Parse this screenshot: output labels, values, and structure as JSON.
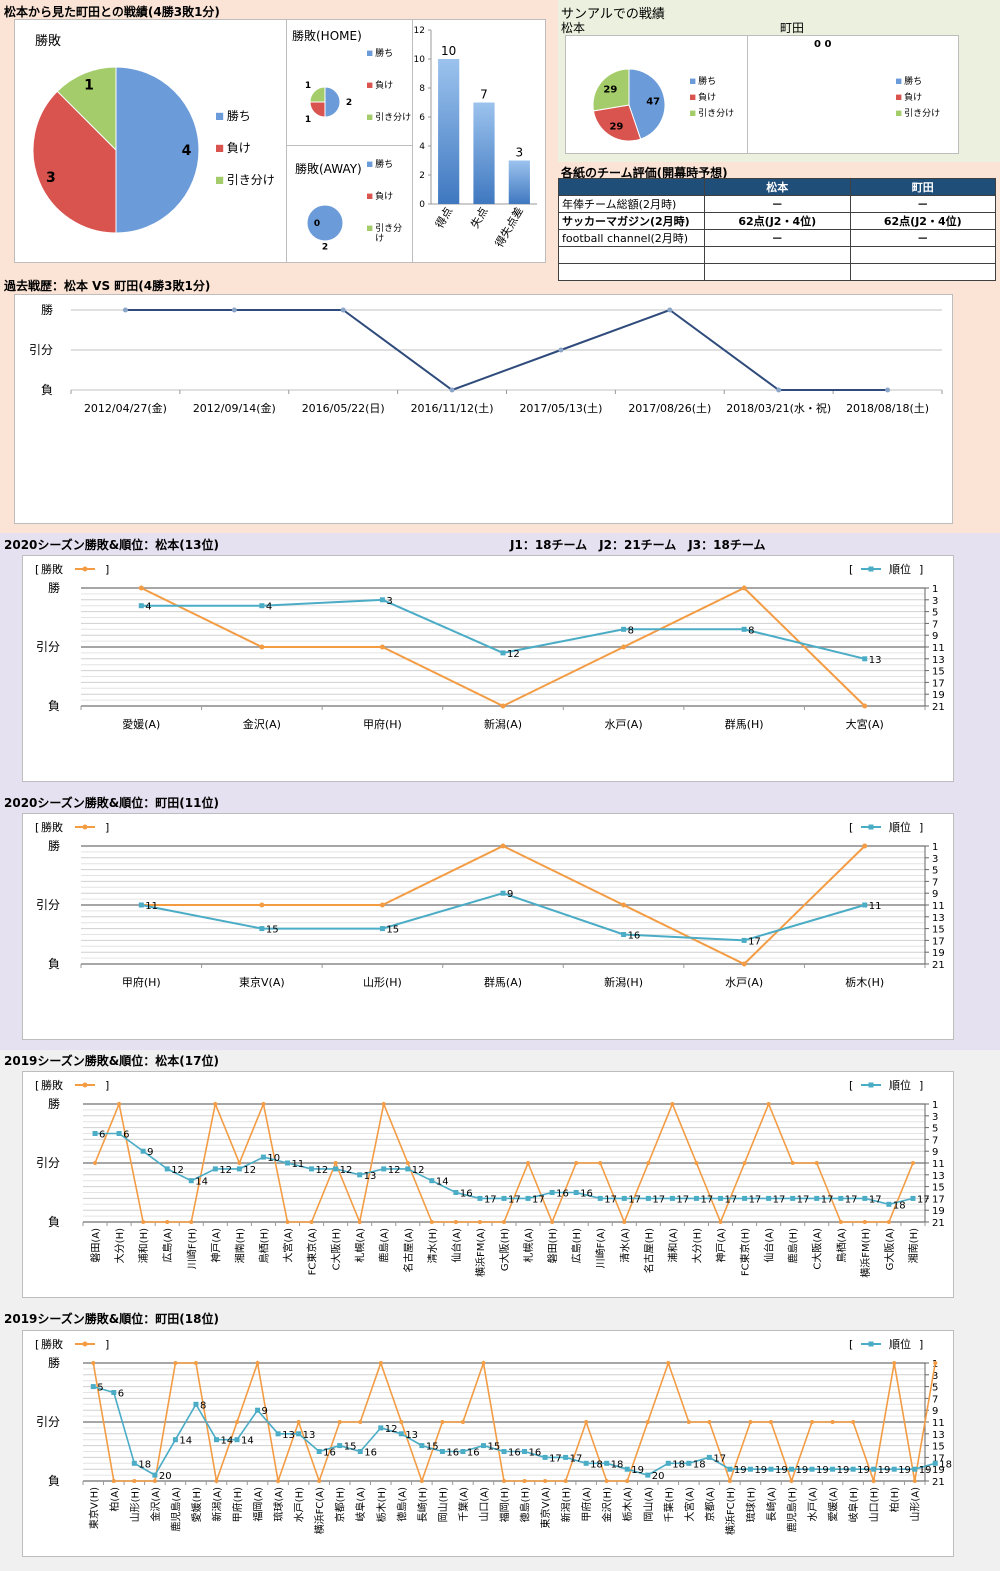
{
  "colors": {
    "win": "#6b9bd8",
    "loss": "#d9534f",
    "draw": "#a4cc6a",
    "orange": "#f39c44",
    "teal": "#4bacc6",
    "navy": "#2f4b7c",
    "peach": "#fbe4d6",
    "lav": "#e6e1f0",
    "gray": "#f0f0f0"
  },
  "head2head": {
    "title": "松本から見た町田との戦績(4勝3敗1分)",
    "pie_title": "勝敗",
    "home_title": "勝敗(HOME)",
    "away_title": "勝敗(AWAY)",
    "legend": [
      "勝ち",
      "負け",
      "引き分け"
    ],
    "legend_small": [
      "勝ち",
      "負け",
      "引き分\nけ"
    ]
  },
  "sanaru": {
    "title": "サンアルでの戦績",
    "left_label": "松本",
    "right_label": "町田",
    "right_zero": "0 0"
  },
  "eval_table": {
    "title": "各紙のチーム評価(開幕時予想)",
    "headers": [
      "",
      "松本",
      "町田"
    ],
    "rows": [
      [
        "年俸チーム総額(2月時)",
        "－",
        "－"
      ],
      [
        "サッカーマガジン(2月時)",
        "62点(J2・4位)",
        "62点(J2・4位)"
      ],
      [
        "football channel(2月時)",
        "－",
        "－"
      ],
      [
        "",
        "",
        ""
      ],
      [
        "",
        "",
        ""
      ]
    ]
  },
  "history": {
    "title": "過去戦歴：松本 VS 町田(4勝3敗1分)"
  },
  "s2020m": {
    "title": "2020シーズン勝敗&順位：松本(13位)",
    "info": "J1：18チーム　J2：21チーム　J3：18チーム"
  },
  "s2020z": {
    "title": "2020シーズン勝敗&順位：町田(11位)"
  },
  "s2019m": {
    "title": "2019シーズン勝敗&順位：松本(17位)"
  },
  "s2019z": {
    "title": "2019シーズン勝敗&順位：町田(18位)"
  },
  "chart_data": [
    {
      "id": "pie_overall",
      "type": "pie",
      "title": "勝敗",
      "labels": [
        "勝ち",
        "負け",
        "引き分け"
      ],
      "values": [
        4,
        3,
        1
      ]
    },
    {
      "id": "pie_home",
      "type": "pie",
      "title": "勝敗(HOME)",
      "labels": [
        "勝ち",
        "負け",
        "引き分け"
      ],
      "values": [
        2,
        1,
        1
      ]
    },
    {
      "id": "pie_away",
      "type": "pie",
      "title": "勝敗(AWAY)",
      "labels": [
        "勝ち",
        "負け",
        "引き分け"
      ],
      "values": [
        2,
        0,
        0
      ]
    },
    {
      "id": "bar_goals",
      "type": "bar",
      "categories": [
        "得点",
        "失点",
        "得失点差"
      ],
      "values": [
        10,
        7,
        3
      ],
      "ylim": [
        0,
        12
      ],
      "yticks": [
        0,
        2,
        4,
        6,
        8,
        10,
        12
      ]
    },
    {
      "id": "pie_sanaru",
      "type": "pie",
      "labels": [
        "勝ち",
        "負け",
        "引き分け"
      ],
      "values": [
        47,
        29,
        29
      ]
    },
    {
      "id": "pie_sanaru_z",
      "type": "pie",
      "labels": [
        "勝ち",
        "負け",
        "引き分け"
      ],
      "values": [
        0,
        0,
        0
      ]
    },
    {
      "id": "history",
      "type": "line",
      "categories": [
        "2012/04/27(金)",
        "2012/09/14(金)",
        "2016/05/22(日)",
        "2016/11/12(土)",
        "2017/05/13(土)",
        "2017/08/26(土)",
        "2018/03/21(水・祝)",
        "2018/08/18(土)"
      ],
      "ylabels": [
        "勝",
        "引分",
        "負"
      ],
      "values": [
        1,
        1,
        1,
        -1,
        0,
        1,
        -1,
        -1
      ]
    },
    {
      "id": "s2020m",
      "type": "line",
      "legend_result": "勝敗",
      "legend_rank": "順位",
      "ylabels": [
        "勝",
        "引分",
        "負"
      ],
      "rank_ticks": [
        1,
        3,
        5,
        7,
        9,
        11,
        13,
        15,
        17,
        19,
        21
      ],
      "categories": [
        "愛媛(A)",
        "金沢(A)",
        "甲府(H)",
        "新潟(A)",
        "水戸(A)",
        "群馬(H)",
        "大宮(A)"
      ],
      "result": [
        1,
        0,
        0,
        -1,
        0,
        1,
        -1
      ],
      "rank": [
        4,
        4,
        3,
        12,
        8,
        8,
        13
      ]
    },
    {
      "id": "s2020z",
      "type": "line",
      "legend_result": "勝敗",
      "legend_rank": "順位",
      "ylabels": [
        "勝",
        "引分",
        "負"
      ],
      "rank_ticks": [
        1,
        3,
        5,
        7,
        9,
        11,
        13,
        15,
        17,
        19,
        21
      ],
      "categories": [
        "甲府(H)",
        "東京V(A)",
        "山形(H)",
        "群馬(A)",
        "新潟(H)",
        "水戸(A)",
        "栃木(H)"
      ],
      "result": [
        0,
        0,
        0,
        1,
        0,
        -1,
        1
      ],
      "rank": [
        11,
        15,
        15,
        9,
        16,
        17,
        11
      ]
    },
    {
      "id": "s2019m",
      "type": "line",
      "legend_result": "勝敗",
      "legend_rank": "順位",
      "ylabels": [
        "勝",
        "引分",
        "負"
      ],
      "rank_ticks": [
        1,
        3,
        5,
        7,
        9,
        11,
        13,
        15,
        17,
        19,
        21
      ],
      "categories": [
        "磐田(A)",
        "大分(H)",
        "浦和(H)",
        "広島(A)",
        "川崎F(H)",
        "神戸(A)",
        "湘南(H)",
        "鳥栖(H)",
        "大宮(A)",
        "FC東京(A)",
        "C大阪(H)",
        "札幌(A)",
        "鹿島(A)",
        "名古屋(A)",
        "清水(H)",
        "仙台(A)",
        "横浜FM(A)",
        "G大阪(H)",
        "札幌(A)",
        "磐田(H)",
        "広島(H)",
        "川崎F(A)",
        "清水(A)",
        "名古屋(H)",
        "浦和(A)",
        "大分(H)",
        "神戸(A)",
        "FC東京(H)",
        "仙台(A)",
        "鹿島(H)",
        "C大阪(A)",
        "鳥栖(A)",
        "横浜FM(H)",
        "G大阪(A)",
        "湘南(H)"
      ],
      "result": [
        0,
        1,
        -1,
        -1,
        -1,
        1,
        0,
        1,
        -1,
        -1,
        0,
        -1,
        1,
        0,
        -1,
        -1,
        -1,
        -1,
        0,
        -1,
        0,
        0,
        -1,
        0,
        1,
        0,
        -1,
        0,
        1,
        0,
        0,
        -1,
        -1,
        -1,
        0
      ],
      "rank": [
        6,
        6,
        9,
        12,
        14,
        12,
        12,
        10,
        11,
        12,
        12,
        13,
        12,
        12,
        14,
        16,
        17,
        17,
        17,
        16,
        16,
        17,
        17,
        17,
        17,
        17,
        17,
        17,
        17,
        17,
        17,
        17,
        17,
        18,
        17
      ]
    },
    {
      "id": "s2019z",
      "type": "line",
      "legend_result": "勝敗",
      "legend_rank": "順位",
      "ylabels": [
        "勝",
        "引分",
        "負"
      ],
      "rank_ticks": [
        1,
        3,
        5,
        7,
        9,
        11,
        13,
        15,
        17,
        19,
        21
      ],
      "categories": [
        "東京V(H)",
        "柏(A)",
        "山形(H)",
        "金沢(A)",
        "鹿児島(A)",
        "愛媛(H)",
        "新潟(A)",
        "甲府(H)",
        "福岡(A)",
        "琉球(A)",
        "水戸(H)",
        "横浜FC(A)",
        "京都(H)",
        "岐阜(A)",
        "栃木(H)",
        "徳島(A)",
        "長崎(H)",
        "岡山(H)",
        "千葉(A)",
        "山口(A)",
        "福岡(H)",
        "徳島(H)",
        "東京V(A)",
        "新潟(H)",
        "甲府(A)",
        "金沢(H)",
        "栃木(A)",
        "岡山(A)",
        "千葉(H)",
        "大宮(A)",
        "京都(A)",
        "横浜FC(H)",
        "琉球(H)",
        "長崎(A)",
        "鹿児島(H)",
        "水戸(A)",
        "愛媛(A)",
        "岐阜(H)",
        "山口(H)",
        "柏(H)",
        "山形(A)"
      ],
      "result": [
        1,
        -1,
        -1,
        -1,
        1,
        1,
        -1,
        0,
        1,
        -1,
        0,
        -1,
        0,
        0,
        1,
        0,
        -1,
        0,
        0,
        1,
        -1,
        -1,
        -1,
        -1,
        0,
        -1,
        -1,
        0,
        1,
        0,
        0,
        -1,
        0,
        0,
        -1,
        0,
        0,
        0,
        -1,
        1,
        -1,
        1
      ],
      "rank": [
        5,
        6,
        18,
        20,
        14,
        8,
        14,
        14,
        9,
        13,
        13,
        16,
        15,
        16,
        12,
        13,
        15,
        16,
        16,
        15,
        16,
        16,
        17,
        17,
        18,
        18,
        19,
        20,
        18,
        18,
        17,
        19,
        19,
        19,
        19,
        19,
        19,
        19,
        19,
        19,
        19,
        18
      ]
    }
  ]
}
